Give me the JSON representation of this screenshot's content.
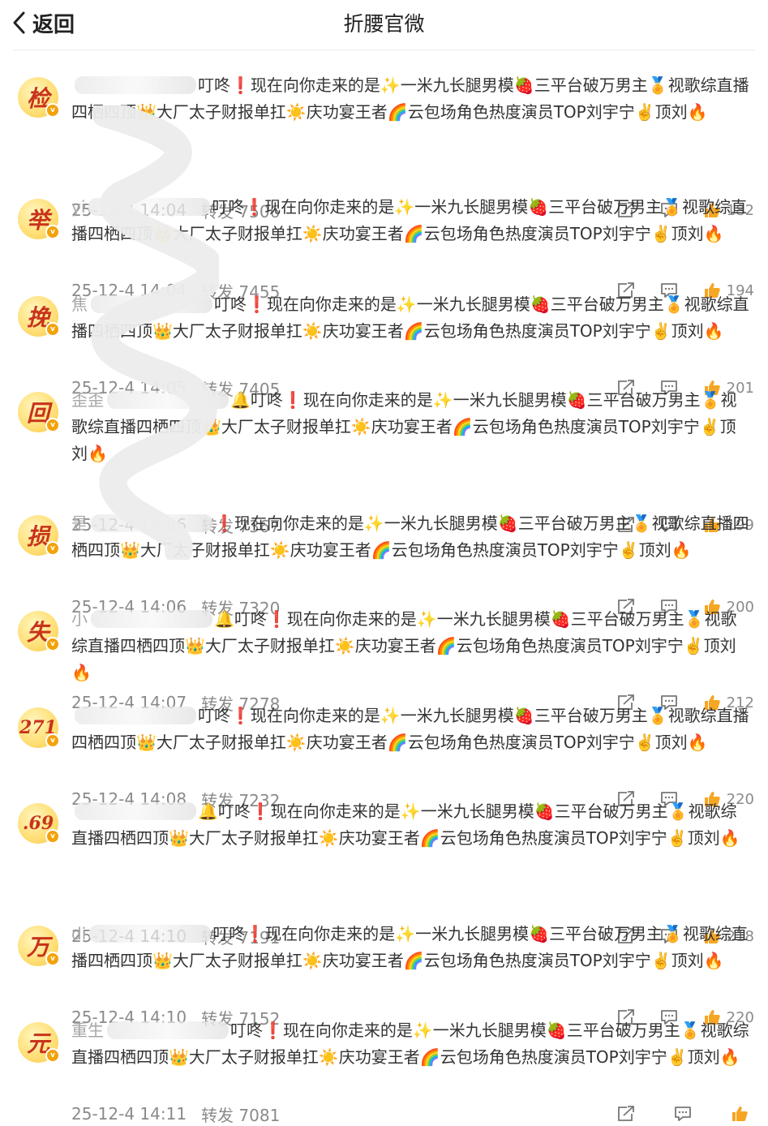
{
  "header": {
    "back_label": "返回",
    "title": "折腰官微"
  },
  "colors": {
    "avatar_bg": "#ffe07a",
    "avatar_text": "#c8331b",
    "meta_text": "#8a8a8a",
    "badge": "#f2a20b"
  },
  "icons": [
    "back-chevron-icon",
    "share-icon",
    "comment-icon",
    "like-icon"
  ],
  "items": [
    {
      "avatar": "检",
      "username": "",
      "content": "叮咚❗现在向你走来的是✨一米九长腿男模🍓三平台破万男主🏅视歌综直播四栖四顶👑大厂太子财报单扛☀️庆功宴王者🌈云包场角色热度演员TOP刘宇宁✌️顶刘🔥",
      "date": "25-12-4 14:04",
      "repost_label": "转发 7506",
      "likes": "182"
    },
    {
      "avatar": "举",
      "username": "yi",
      "content": "叮咚❗现在向你走来的是✨一米九长腿男模🍓三平台破万男主🏅视歌综直播四栖四顶👑大厂太子财报单扛☀️庆功宴王者🌈云包场角色热度演员TOP刘宇宁✌️顶刘🔥",
      "date": "25-12-4 14:04",
      "repost_label": "转发 7455",
      "likes": "194"
    },
    {
      "avatar": "挽",
      "username": "焦",
      "content": "叮咚❗现在向你走来的是✨一米九长腿男模🍓三平台破万男主🏅视歌综直播四栖四顶👑大厂太子财报单扛☀️庆功宴王者🌈云包场角色热度演员TOP刘宇宁✌️顶刘🔥",
      "date": "25-12-4 14:05",
      "repost_label": "转发 7405",
      "likes": "201"
    },
    {
      "avatar": "回",
      "username": "歪歪",
      "content": "🔔叮咚❗现在向你走来的是✨一米九长腿男模🍓三平台破万男主🏅视歌综直播四栖四顶👑大厂太子财报单扛☀️庆功宴王者🌈云包场角色热度演员TOP刘宇宁✌️顶刘🔥",
      "date": "25-12-4 14:06",
      "repost_label": "转发 7367",
      "likes": "199"
    },
    {
      "avatar": "损",
      "username": "是",
      "content": "❗现在向你走来的是✨一米九长腿男模🍓三平台破万男主🏅视歌综直播四栖四顶👑大厂太子财报单扛☀️庆功宴王者🌈云包场角色热度演员TOP刘宇宁✌️顶刘🔥",
      "date": "25-12-4 14:06",
      "repost_label": "转发 7320",
      "likes": "200"
    },
    {
      "avatar": "失",
      "username": "小",
      "content": "🔔叮咚❗现在向你走来的是✨一米九长腿男模🍓三平台破万男主🏅视歌综直播四栖四顶👑大厂太子财报单扛☀️庆功宴王者🌈云包场角色热度演员TOP刘宇宁✌️顶刘🔥",
      "date": "25-12-4 14:07",
      "repost_label": "转发 7278",
      "likes": "212"
    },
    {
      "avatar": "271",
      "username": "",
      "content": "叮咚❗现在向你走来的是✨一米九长腿男模🍓三平台破万男主🏅视歌综直播四栖四顶👑大厂太子财报单扛☀️庆功宴王者🌈云包场角色热度演员TOP刘宇宁✌️顶刘🔥",
      "date": "25-12-4 14:08",
      "repost_label": "转发 7232",
      "likes": "220"
    },
    {
      "avatar": ".69",
      "username": "",
      "content": "🔔叮咚❗现在向你走来的是✨一米九长腿男模🍓三平台破万男主🏅视歌综直播四栖四顶👑大厂太子财报单扛☀️庆功宴王者🌈云包场角色热度演员TOP刘宇宁✌️顶刘🔥",
      "date": "25-12-4 14:10",
      "repost_label": "转发 7191",
      "likes": "218"
    },
    {
      "avatar": "万",
      "username": "di",
      "content": "叮咚❗现在向你走来的是✨一米九长腿男模🍓三平台破万男主🏅视歌综直播四栖四顶👑大厂太子财报单扛☀️庆功宴王者🌈云包场角色热度演员TOP刘宇宁✌️顶刘🔥",
      "date": "25-12-4 14:10",
      "repost_label": "转发 7152",
      "likes": "220"
    },
    {
      "avatar": "元",
      "username": "重生",
      "content": "叮咚❗现在向你走来的是✨一米九长腿男模🍓三平台破万男主🏅视歌综直播四栖四顶👑大厂太子财报单扛☀️庆功宴王者🌈云包场角色热度演员TOP刘宇宁✌️顶刘🔥",
      "date": "25-12-4 14:11",
      "repost_label": "转发 7081",
      "likes": ""
    }
  ]
}
